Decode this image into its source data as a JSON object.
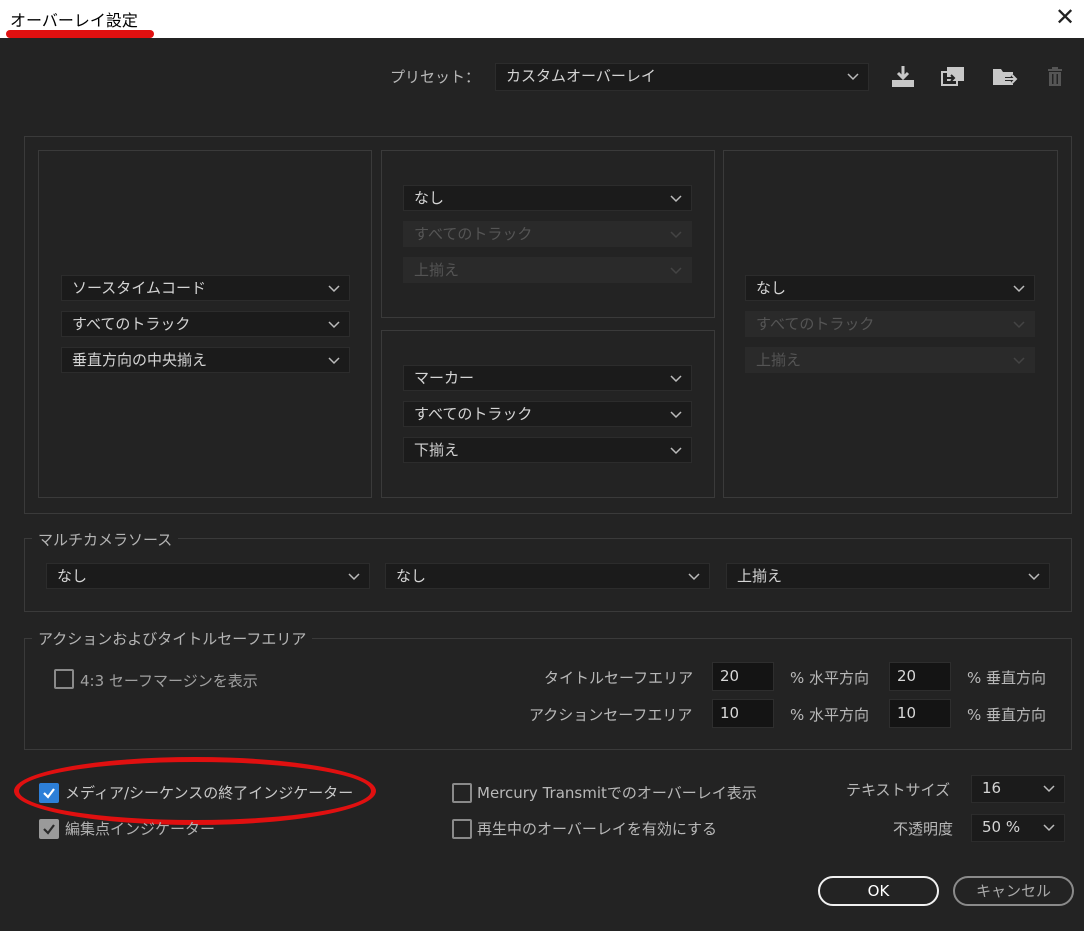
{
  "window": {
    "title": "オーバーレイ設定",
    "close_glyph": "✕"
  },
  "preset": {
    "label": "プリセット：",
    "value": "カスタムオーバーレイ"
  },
  "overlay": {
    "left": {
      "source": "ソースタイムコード",
      "track": "すべてのトラック",
      "align": "垂直方向の中央揃え"
    },
    "center_top": {
      "source": "なし",
      "track": "すべてのトラック",
      "align": "上揃え"
    },
    "center_bottom": {
      "source": "マーカー",
      "track": "すべてのトラック",
      "align": "下揃え"
    },
    "right": {
      "source": "なし",
      "track": "すべてのトラック",
      "align": "上揃え"
    }
  },
  "multicam": {
    "legend": "マルチカメラソース",
    "select1": "なし",
    "select2": "なし",
    "select3": "上揃え"
  },
  "safe_area": {
    "legend": "アクションおよびタイトルセーフエリア",
    "margin_label": "4:3 セーフマージンを表示",
    "title_label": "タイトルセーフエリア",
    "title_h": "20",
    "title_v": "20",
    "action_label": "アクションセーフエリア",
    "action_h": "10",
    "action_v": "10",
    "h_unit": "% 水平方向",
    "v_unit": "% 垂直方向"
  },
  "options": {
    "media_end": "メディア/シーケンスの終了インジケーター",
    "edit_point": "編集点インジケーター",
    "mercury": "Mercury  Transmitでのオーバーレイ表示",
    "playback": "再生中のオーバーレイを有効にする",
    "text_size_label": "テキストサイズ",
    "text_size": "16",
    "opacity_label": "不透明度",
    "opacity": "50 %"
  },
  "buttons": {
    "ok": "OK",
    "cancel": "キャンセル"
  },
  "colors": {
    "annotation_red": "#e01010",
    "checkbox_blue": "#2d7fd8",
    "background": "#232323"
  },
  "icons": [
    "download-icon",
    "import-preset-icon",
    "export-preset-icon",
    "trash-icon",
    "chevron-down-icon",
    "checkmark-icon"
  ]
}
